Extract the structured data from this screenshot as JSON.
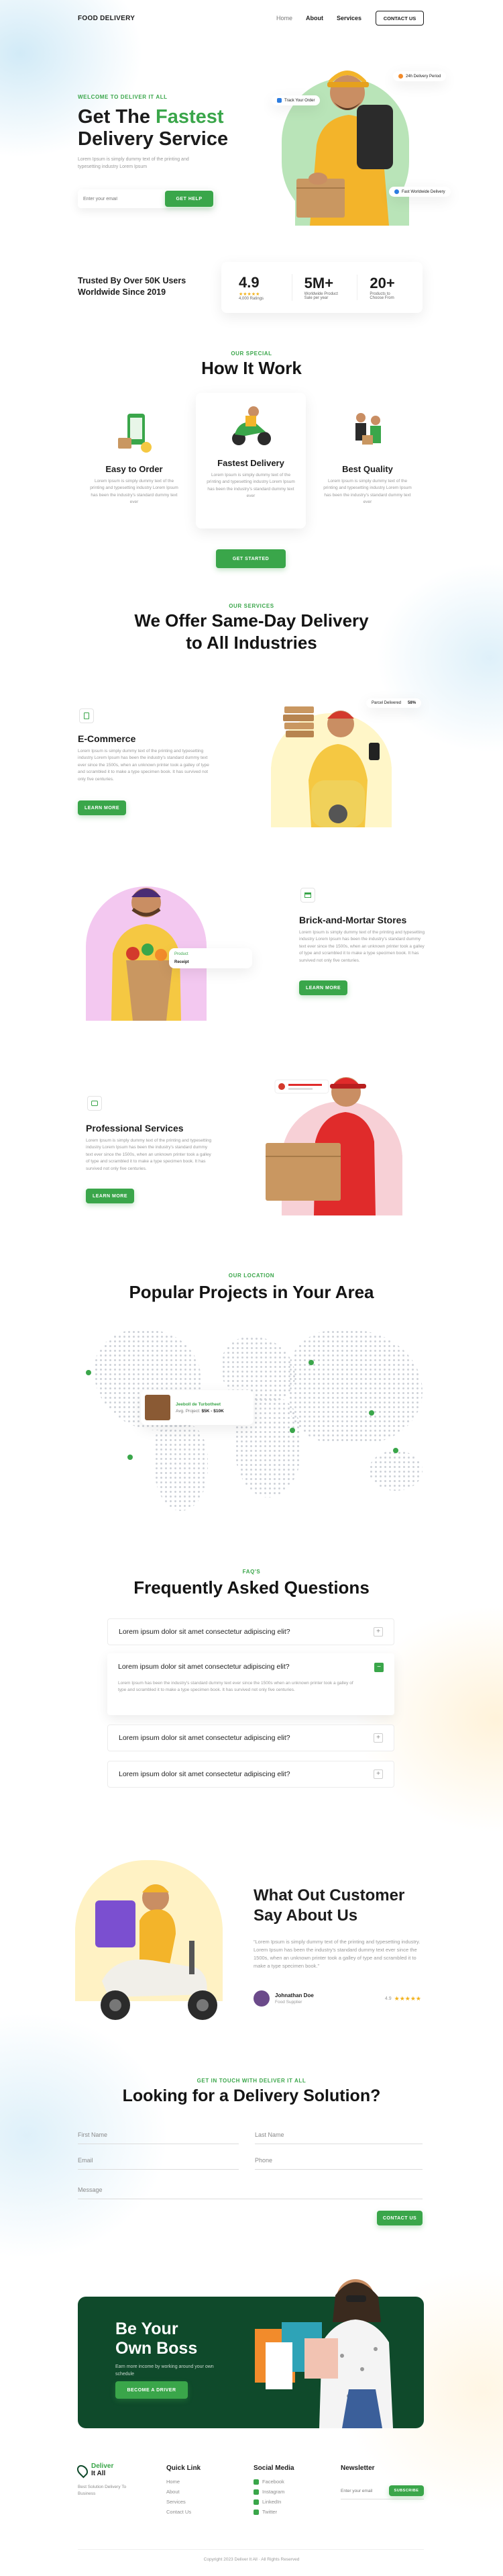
{
  "header": {
    "logo": "FOOD DELIVERY",
    "nav": [
      "Home",
      "About",
      "Services"
    ],
    "contact": "CONTACT US"
  },
  "hero": {
    "eyebrow": "WELCOME TO DELIVER IT ALL",
    "title_a": "Get The ",
    "title_b": "Fastest",
    "title_c": "Delivery Service",
    "desc": "Lorem Ipsum is simply dummy text of the printing and typesetting industry Lorem Ipsum",
    "input_placeholder": "Enter your email",
    "cta": "GET HELP",
    "tag1": "Track Your Order",
    "tag2": "24h Delivery Period",
    "tag3": "Fast Worldwide Delivery"
  },
  "trust": {
    "text": "Trusted By Over 50K Users Worldwide Since 2019",
    "stats": [
      {
        "value": "4.9",
        "label": "4,000 Ratings",
        "stars": "★★★★★"
      },
      {
        "value": "5M+",
        "label": "Worldwide Product Sale per year"
      },
      {
        "value": "20+",
        "label": "Products to Choose From"
      }
    ]
  },
  "how": {
    "eyebrow": "OUR SPECIAL",
    "title": "How It Work",
    "steps": [
      {
        "title": "Easy to Order",
        "desc": "Lorem Ipsum is simply dummy text of the printing and typesetting industry Lorem Ipsum has been the industry's standard dummy text ever"
      },
      {
        "title": "Fastest Delivery",
        "desc": "Lorem Ipsum is simply dummy text of the printing and typesetting industry Lorem Ipsum has been the industry's standard dummy text ever"
      },
      {
        "title": "Best Quality",
        "desc": "Lorem Ipsum is simply dummy text of the printing and typesetting industry Lorem Ipsum has been the industry's standard dummy text ever"
      }
    ],
    "cta": "GET STARTED"
  },
  "services": {
    "eyebrow": "OUR SERVICES",
    "title1": "We Offer Same-Day Delivery",
    "title2": "to All Industries",
    "items": [
      {
        "title": "E-Commerce",
        "desc": "Lorem Ipsum is simply dummy text of the printing and typesetting industry Lorem Ipsum has been the industry's standard dummy text ever since the 1500s, when an unknown printer took a galley of type and scrambled it to make a type specimen book. It has survived not only five centuries.",
        "cta": "LEARN MORE",
        "badge": "Parcel Delivered",
        "badge_val": "58%"
      },
      {
        "title": "Brick-and-Mortar Stores",
        "desc": "Lorem Ipsum is simply dummy text of the printing and typesetting industry Lorem Ipsum has been the industry's standard dummy text ever since the 1500s, when an unknown printer took a galley of type and scrambled it to make a type specimen book. It has survived not only five centuries.",
        "cta": "LEARN MORE",
        "badge1": "Product",
        "badge2": "Receipt"
      },
      {
        "title": "Professional Services",
        "desc": "Lorem Ipsum is simply dummy text of the printing and typesetting industry Lorem Ipsum has been the industry's standard dummy text ever since the 1500s, when an unknown printer took a galley of type and scrambled it to make a type specimen book. It has survived not only five centuries.",
        "cta": "LEARN MORE"
      }
    ]
  },
  "location": {
    "eyebrow": "OUR LOCATION",
    "title": "Popular Projects in Your Area",
    "popup_title": "Jeeboll de Turbotheet",
    "popup_sub": "Avg. Project:",
    "popup_price": "$5K - $10K"
  },
  "faq": {
    "eyebrow": "FAQ'S",
    "title": "Frequently Asked Questions",
    "items": [
      {
        "q": "Lorem ipsum dolor sit amet consectetur adipiscing elit?",
        "sign": "+"
      },
      {
        "q": "Lorem ipsum dolor sit amet consectetur adipiscing elit?",
        "sign": "−",
        "a": "Lorem Ipsum has been the industry's standard dummy text ever since the 1500s when an unknown printer took a galley of type and scrambled it to make a type specimen book. It has survived not only five centuries."
      },
      {
        "q": "Lorem ipsum dolor sit amet consectetur adipiscing elit?",
        "sign": "+"
      },
      {
        "q": "Lorem ipsum dolor sit amet consectetur adipiscing elit?",
        "sign": "+"
      }
    ]
  },
  "testimonial": {
    "title1": "What Out Customer",
    "title2": "Say About Us",
    "quote": "“Lorem Ipsum is simply dummy text of the printing and typesetting industry. Lorem Ipsum has been the industry's standard dummy text ever since the 1500s, when an unknown printer took a galley of type and scrambled it to make a type specimen book.”",
    "name": "Johnathan Doe",
    "role": "Food Supplier",
    "rating": "4.9",
    "stars": "★★★★★"
  },
  "contact": {
    "eyebrow": "GET IN TOUCH WITH DELIVER IT ALL",
    "title": "Looking for a Delivery Solution?",
    "first": "First Name",
    "last": "Last Name",
    "email": "Email",
    "phone": "Phone",
    "message": "Message",
    "cta": "CONTACT US"
  },
  "promo": {
    "title1": "Be Your",
    "title2": "Own Boss",
    "desc": "Earn more income by working around your own schedule",
    "cta": "BECOME A DRIVER"
  },
  "footer": {
    "brand1": "Deliver",
    "brand2": "It All",
    "tagline": "Best Solution Delivery To Business",
    "quick_title": "Quick Link",
    "quick": [
      "Home",
      "About",
      "Services",
      "Contact Us"
    ],
    "social_title": "Social Media",
    "social": [
      "Facebook",
      "Instagram",
      "LinkedIn",
      "Twitter"
    ],
    "news_title": "Newsletter",
    "news_placeholder": "Enter your email",
    "news_cta": "SUBSCRIBE",
    "copyright": "Copyright 2023 Deliver It All · All Rights Reserved"
  },
  "colors": {
    "accent": "#3aa64a",
    "dark_green": "#0f4a2b",
    "yellow": "#f5c842"
  }
}
